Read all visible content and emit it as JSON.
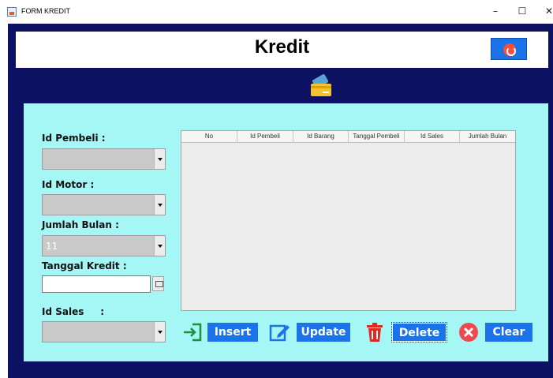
{
  "window": {
    "title": "FORM KREDIT",
    "minimize": "–",
    "maximize": "☐",
    "close": "✕"
  },
  "header": {
    "title": "Kredit"
  },
  "icons": {
    "exit": "exit-icon",
    "card": "credit-card-icon",
    "insert": "sign-in-icon",
    "update": "edit-icon",
    "delete": "trash-icon",
    "clear": "clear-x-icon"
  },
  "colors": {
    "frame": "#0d1162",
    "panel": "#a4f7f5",
    "button": "#1a73e8",
    "delete_icon": "#e02a1d",
    "insert_icon": "#1f8f3a"
  },
  "form": {
    "id_pembeli_label": "Id Pembeli :",
    "id_motor_label": "Id Motor :",
    "jumlah_bulan_label": "Jumlah Bulan :",
    "jumlah_bulan_value": "11",
    "tanggal_kredit_label": "Tanggal Kredit :",
    "id_sales_label": "Id Sales     :"
  },
  "table": {
    "columns": [
      "No",
      "Id Pembeli",
      "Id Barang",
      "Tanggal Pembeli",
      "Id Sales",
      "Jumlah Bulan"
    ]
  },
  "buttons": {
    "insert": "Insert",
    "update": "Update",
    "delete": "Delete",
    "clear": "Clear"
  }
}
